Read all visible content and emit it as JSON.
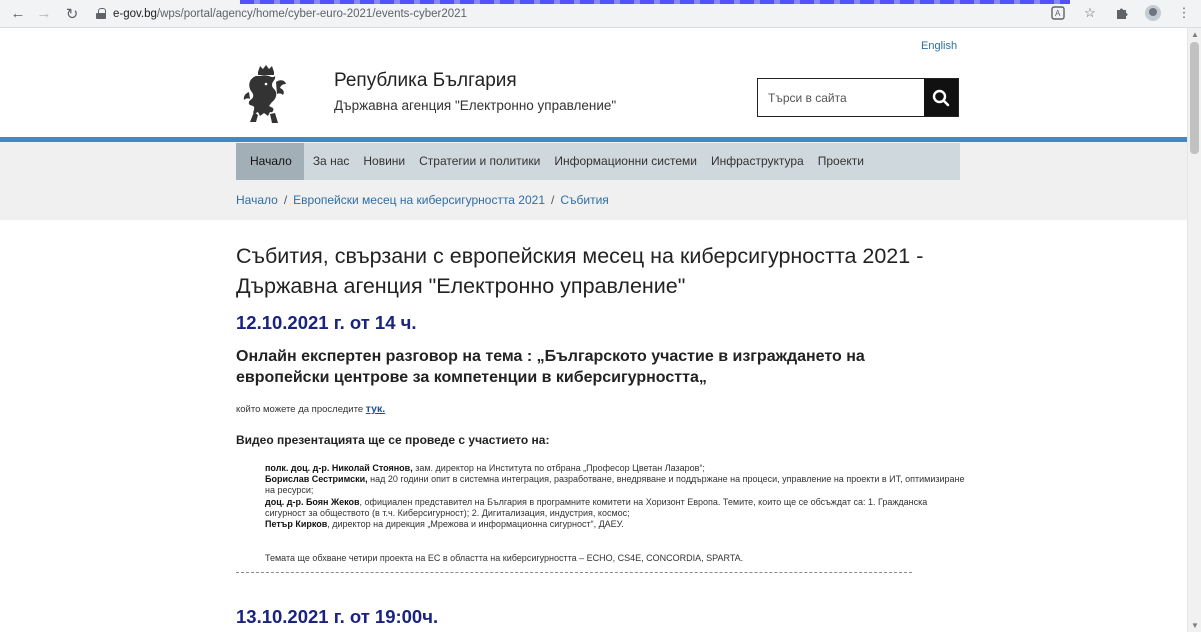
{
  "browser": {
    "url_host": "e-gov.bg",
    "url_path": "/wps/portal/agency/home/cyber-euro-2021/events-cyber2021"
  },
  "header": {
    "lang_link": "English",
    "title": "Република България",
    "subtitle": "Държавна агенция \"Електронно управление\"",
    "search_placeholder": "Търси в сайта"
  },
  "nav": {
    "items": [
      {
        "label": "Начало"
      },
      {
        "label": "За нас"
      },
      {
        "label": "Новини"
      },
      {
        "label": "Стратегии и политики"
      },
      {
        "label": "Информационни системи"
      },
      {
        "label": "Инфраструктура"
      },
      {
        "label": "Проекти"
      }
    ]
  },
  "breadcrumb": {
    "items": [
      "Начало",
      "Европейски месец на киберсигурността 2021",
      "Събития"
    ],
    "separator": "/"
  },
  "content": {
    "page_title": "Събития, свързани с европейския месец на киберсигурността 2021 - Държавна агенция \"Електронно управление\"",
    "event1_date": "12.10.2021 г. от 14 ч.",
    "event1_heading": "Онлайн експертен разговор на тема : „Българското участие в изграждането на европейски центрове за компетенции в киберсигурността„",
    "watch_text": "който можете да проследите ",
    "watch_link": "тук.",
    "video_intro": "Видео презентацията ще се проведе с участието на:",
    "participants": [
      {
        "name": "полк. доц. д-р. Николай Стоянов,",
        "desc": " зам. директор на Института по отбрана „Професор Цветан Лазаров“;"
      },
      {
        "name": "Борислав Сестримски,",
        "desc": " над 20 години опит в системна интеграция, разработване, внедряване и поддържане на процеси, управление  на проекти в ИТ, оптимизиране на ресурси;"
      },
      {
        "name": "доц. д-р. Боян Жеков",
        "desc": ", официален представител на България в програмните комитети на Хоризонт Европа. Темите, които ще се  обсъждат са: 1. Гражданска сигурност за обществото (в т.ч. Киберсигурност); 2. Дигитализация, индустрия, космос;"
      },
      {
        "name": "Петър Кирков",
        "desc": ", директор на дирекция „Мрежова и информационна сигурност“, ДАЕУ."
      }
    ],
    "topic_line": "Темата ще обхване четири проекта на ЕС в областта на киберсигурността – ECHO, CS4E, CONCORDIA, SPARTA.",
    "event2_date": "13.10.2021 г. от 19:00ч."
  },
  "icons": {
    "back": "arrow-left-icon",
    "forward": "arrow-right-icon",
    "reload": "reload-icon",
    "lock": "lock-icon",
    "translate": "translate-icon",
    "bookmark": "star-icon",
    "extensions": "puzzle-icon",
    "profile": "profile-icon",
    "menu": "kebab-menu-icon",
    "search": "search-icon",
    "logo": "lion-coat-of-arms-icon"
  },
  "colors": {
    "accent_blue": "#3f89c6",
    "nav_bg": "#cfd8dc",
    "nav_active": "#a3afb6",
    "date_color": "#1a237e",
    "link": "#2e6ea6"
  }
}
